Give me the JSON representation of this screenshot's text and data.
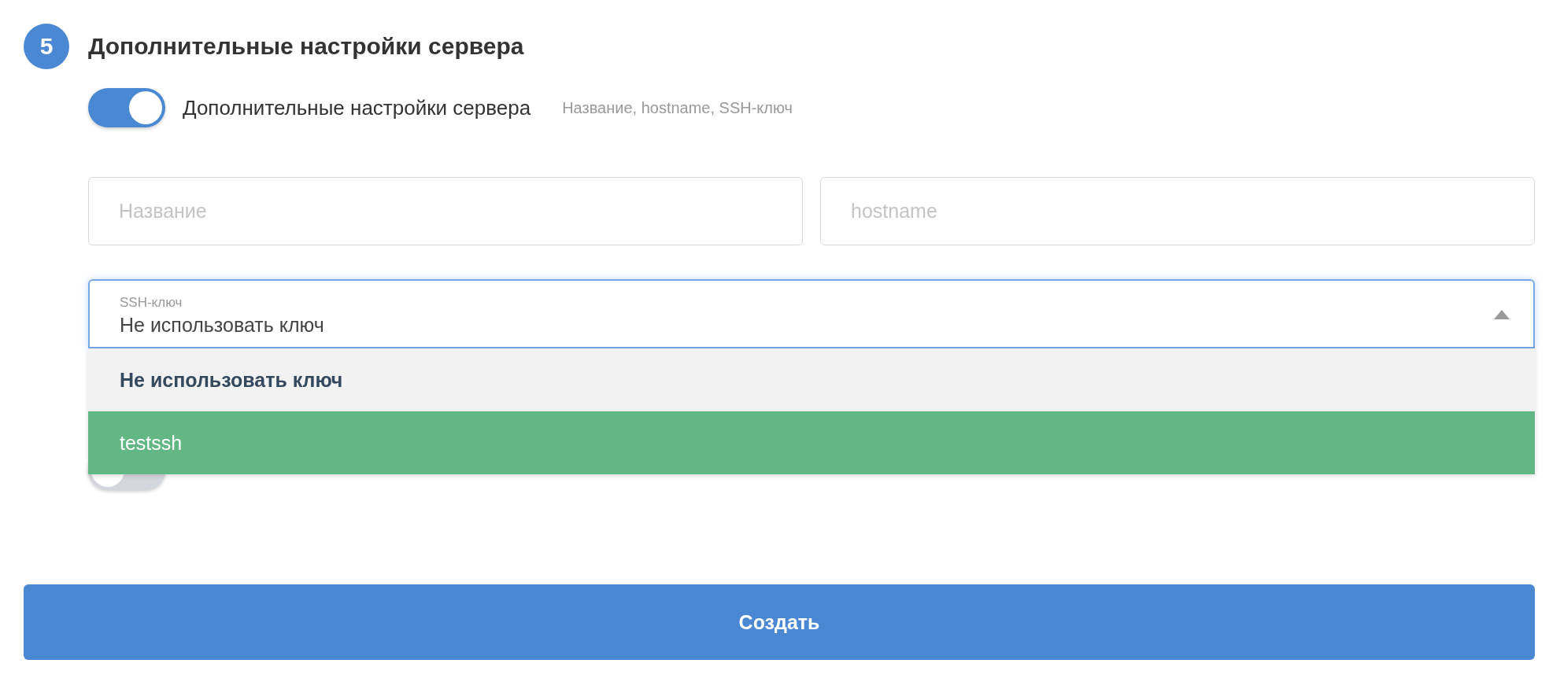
{
  "section": {
    "step": "5",
    "title": "Дополнительные настройки сервера"
  },
  "advanced_toggle": {
    "label": "Дополнительные настройки сервера",
    "hint": "Название, hostname, SSH-ключ",
    "on": true
  },
  "fields": [
    {
      "placeholder": "Название"
    },
    {
      "placeholder": "hostname"
    }
  ],
  "ssh_select": {
    "label": "SSH-ключ",
    "value": "Не использовать ключ",
    "expanded": true,
    "options": [
      {
        "label": "Не использовать ключ",
        "selected": true,
        "highlighted": false
      },
      {
        "label": "testssh",
        "selected": false,
        "highlighted": true
      }
    ]
  },
  "backup_ip_toggle": {
    "on": false
  },
  "submit_button": "Создать"
}
